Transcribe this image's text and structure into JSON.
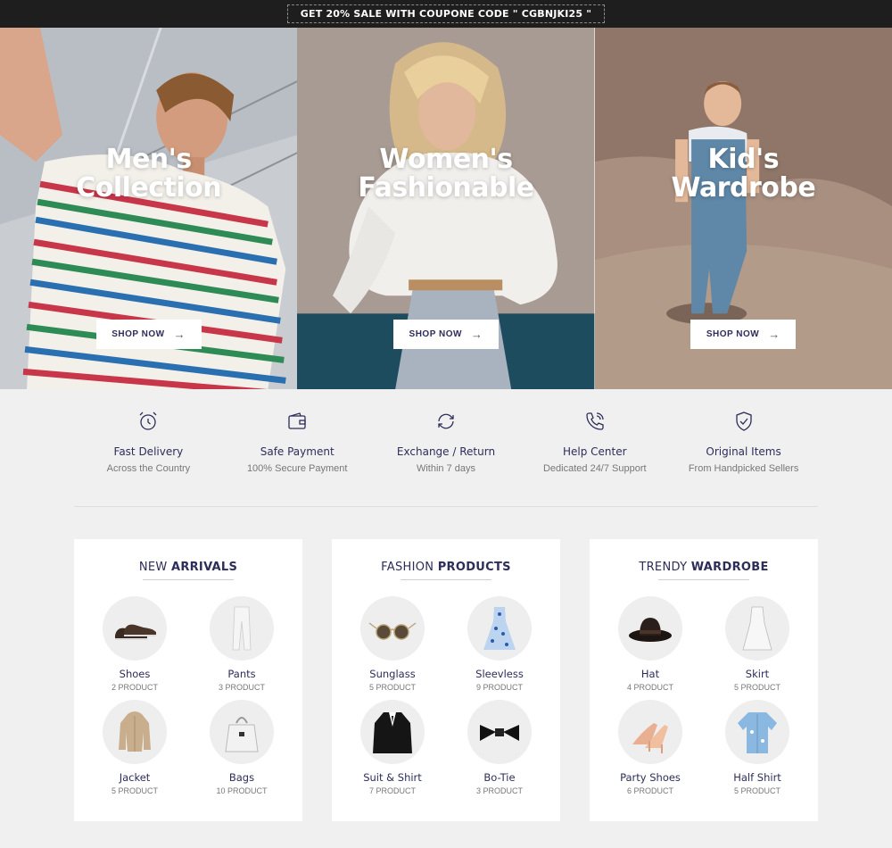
{
  "topbar": {
    "coupon_text": "GET 20% SALE WITH COUPONE CODE \" CGBNJKI25 \""
  },
  "hero": {
    "panels": [
      {
        "title_line1": "Men's",
        "title_line2": "Collection",
        "button": "SHOP NOW"
      },
      {
        "title_line1": "Women's",
        "title_line2": "Fashionable",
        "button": "SHOP NOW"
      },
      {
        "title_line1": "Kid's",
        "title_line2": "Wardrobe",
        "button": "SHOP NOW"
      }
    ],
    "arrow": "→"
  },
  "features": [
    {
      "icon": "alarm-clock-icon",
      "title": "Fast Delivery",
      "subtitle": "Across the Country"
    },
    {
      "icon": "wallet-icon",
      "title": "Safe Payment",
      "subtitle": "100% Secure Payment"
    },
    {
      "icon": "exchange-icon",
      "title": "Exchange / Return",
      "subtitle": "Within 7 days"
    },
    {
      "icon": "phone-icon",
      "title": "Help Center",
      "subtitle": "Dedicated 24/7 Support"
    },
    {
      "icon": "shield-check-icon",
      "title": "Original Items",
      "subtitle": "From Handpicked Sellers"
    }
  ],
  "categories": [
    {
      "title_normal": "NEW ",
      "title_bold": "ARRIVALS",
      "items": [
        {
          "name": "Shoes",
          "count": "2 PRODUCT"
        },
        {
          "name": "Pants",
          "count": "3 PRODUCT"
        },
        {
          "name": "Jacket",
          "count": "5 PRODUCT"
        },
        {
          "name": "Bags",
          "count": "10 PRODUCT"
        }
      ]
    },
    {
      "title_normal": "FASHION ",
      "title_bold": "PRODUCTS",
      "items": [
        {
          "name": "Sunglass",
          "count": "5 PRODUCT"
        },
        {
          "name": "Sleevless",
          "count": "9 PRODUCT"
        },
        {
          "name": "Suit & Shirt",
          "count": "7 PRODUCT"
        },
        {
          "name": "Bo-Tie",
          "count": "3 PRODUCT"
        }
      ]
    },
    {
      "title_normal": "TRENDY ",
      "title_bold": "WARDROBE",
      "items": [
        {
          "name": "Hat",
          "count": "4 PRODUCT"
        },
        {
          "name": "Skirt",
          "count": "5 PRODUCT"
        },
        {
          "name": "Party Shoes",
          "count": "6 PRODUCT"
        },
        {
          "name": "Half Shirt",
          "count": "5 PRODUCT"
        }
      ]
    }
  ],
  "colors": {
    "accent": "#2d2d5a",
    "topbar": "#1e1e1e",
    "page_bg": "#f0f0f0"
  }
}
